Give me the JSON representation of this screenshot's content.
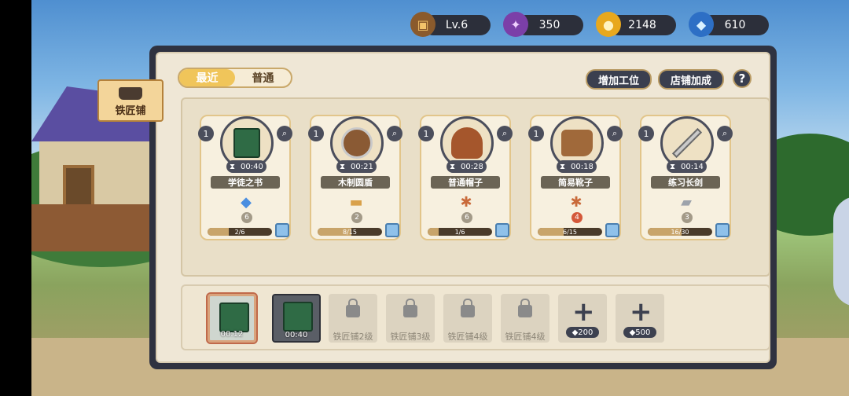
{
  "status_bar": {
    "level": "Lv.6",
    "gems": "350",
    "gold": "2148",
    "diamonds": "610",
    "icons": [
      "chest-icon",
      "gem-icon",
      "gold-coin-icon",
      "diamond-plus-icon"
    ]
  },
  "shop": {
    "name": "铁匠铺"
  },
  "tabs": [
    {
      "label": "最近",
      "active": true
    },
    {
      "label": "普通",
      "active": false
    }
  ],
  "buttons": {
    "add_workstation": "增加工位",
    "shop_bonus": "店铺加成",
    "help": "?"
  },
  "items": [
    {
      "level": "1",
      "name": "学徒之书",
      "time": "00:40",
      "icon": "green-book-icon",
      "material": "crystal-icon",
      "material_count": "6",
      "progress_text": "2/6",
      "progress": 0.33
    },
    {
      "level": "1",
      "name": "木制圆盾",
      "time": "00:21",
      "icon": "wooden-shield-icon",
      "material": "wood-plank-icon",
      "material_count": "2",
      "progress_text": "8/15",
      "progress": 0.53
    },
    {
      "level": "1",
      "name": "普通帽子",
      "time": "00:28",
      "icon": "hood-icon",
      "material": "leather-icon",
      "material_count": "6",
      "progress_text": "1/6",
      "progress": 0.17
    },
    {
      "level": "1",
      "name": "简易靴子",
      "time": "00:18",
      "icon": "boots-icon",
      "material": "leather-icon",
      "material_count": "4",
      "progress_text": "6/15",
      "progress": 0.4
    },
    {
      "level": "1",
      "name": "练习长剑",
      "time": "00:14",
      "icon": "sword-icon",
      "material": "iron-ingot-icon",
      "material_count": "3",
      "progress_text": "16/30",
      "progress": 0.53
    }
  ],
  "slots": [
    {
      "type": "active",
      "time": "00:12"
    },
    {
      "type": "filled",
      "time": "00:40"
    },
    {
      "type": "locked",
      "label": "铁匠铺2级"
    },
    {
      "type": "locked",
      "label": "铁匠铺3级"
    },
    {
      "type": "locked",
      "label": "铁匠铺4级"
    },
    {
      "type": "locked",
      "label": "铁匠铺4级"
    },
    {
      "type": "buy",
      "cost": "200"
    },
    {
      "type": "buy",
      "cost": "500"
    }
  ]
}
